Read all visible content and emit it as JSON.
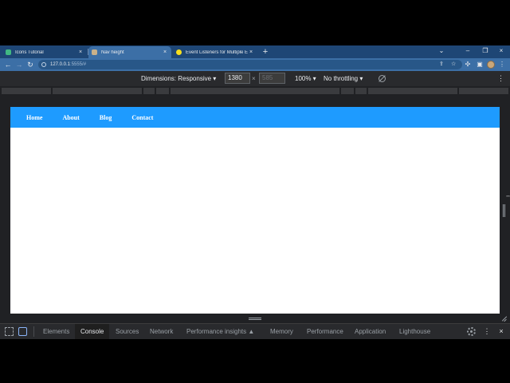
{
  "tabs": [
    {
      "title": "Icons Tutorial",
      "favicon_color": "#41b883"
    },
    {
      "title": "Nav height",
      "favicon_color": "#c9b18a"
    },
    {
      "title": "Event Listeners for Multiple Elem",
      "favicon_color": "#f7df1e"
    }
  ],
  "tab_close_glyph": "×",
  "new_tab_glyph": "+",
  "window_controls": {
    "dropdown": "⌄",
    "minimize": "–",
    "maximize": "❐",
    "close": "×"
  },
  "toolbar": {
    "back_glyph": "←",
    "forward_glyph": "→",
    "reload_glyph": "↻",
    "url_host": "127.0.0.1",
    "url_rest": ":5555/#",
    "icons": [
      "share-icon",
      "star-icon",
      "extensions-icon",
      "sidebar-icon",
      "profile-avatar",
      "more-icon"
    ]
  },
  "device_toolbar": {
    "dimensions_label": "Dimensions: Responsive ▾",
    "width_value": "1380",
    "height_placeholder": "585",
    "times_glyph": "×",
    "zoom_label": "100% ▾",
    "throttling_label": "No throttling ▾",
    "more_glyph": "⋮"
  },
  "page": {
    "nav_color": "#1e9bff",
    "nav_links": [
      "Home",
      "About",
      "Blog",
      "Contact"
    ]
  },
  "devtools": {
    "tabs": [
      "Elements",
      "Console",
      "Sources",
      "Network",
      "Performance insights ▲",
      "Memory",
      "Performance",
      "Application",
      "Lighthouse"
    ],
    "active_tab": "Console",
    "more_glyph": "⋮",
    "close_glyph": "×"
  }
}
